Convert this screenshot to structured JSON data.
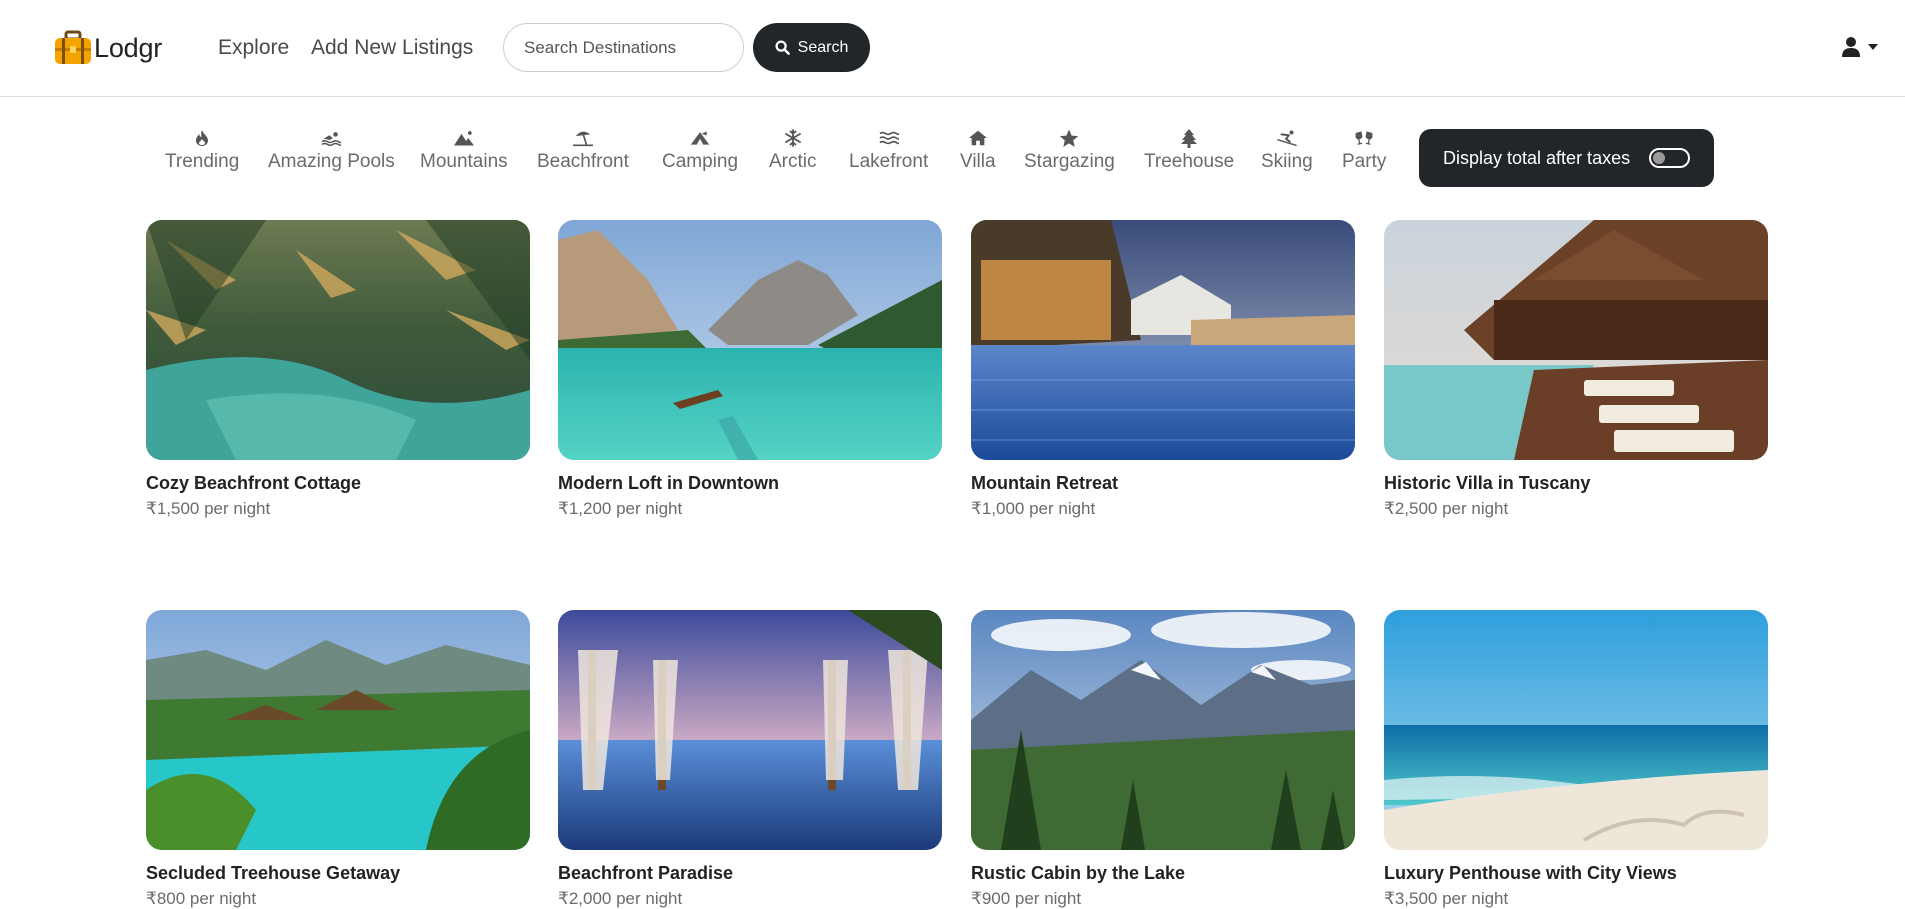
{
  "brand": {
    "name": "Lodgr",
    "icon": "suitcase-icon"
  },
  "nav": {
    "explore": "Explore",
    "add_listing": "Add New Listings"
  },
  "search": {
    "placeholder": "Search Destinations",
    "button_label": "Search"
  },
  "user_menu": {
    "icon": "user-icon",
    "caret": "caret-down-icon"
  },
  "filters": [
    {
      "label": "Trending",
      "icon": "fire-icon"
    },
    {
      "label": "Amazing Pools",
      "icon": "swimmer-icon"
    },
    {
      "label": "Mountains",
      "icon": "mountain-icon"
    },
    {
      "label": "Beachfront",
      "icon": "umbrella-beach-icon"
    },
    {
      "label": "Camping",
      "icon": "campground-icon"
    },
    {
      "label": "Arctic",
      "icon": "snowflake-icon"
    },
    {
      "label": "Lakefront",
      "icon": "water-icon"
    },
    {
      "label": "Villa",
      "icon": "house-icon"
    },
    {
      "label": "Stargazing",
      "icon": "star-icon"
    },
    {
      "label": "Treehouse",
      "icon": "tree-icon"
    },
    {
      "label": "Skiing",
      "icon": "skiing-icon"
    },
    {
      "label": "Party",
      "icon": "glasses-cheers-icon"
    }
  ],
  "tax_toggle": {
    "label": "Display total after taxes",
    "enabled": false
  },
  "listings": [
    {
      "title": "Cozy Beachfront Cottage",
      "price": "₹1,500 per night"
    },
    {
      "title": "Modern Loft in Downtown",
      "price": "₹1,200 per night"
    },
    {
      "title": "Mountain Retreat",
      "price": "₹1,000 per night"
    },
    {
      "title": "Historic Villa in Tuscany",
      "price": "₹2,500 per night"
    },
    {
      "title": "Secluded Treehouse Getaway",
      "price": "₹800 per night"
    },
    {
      "title": "Beachfront Paradise",
      "price": "₹2,000 per night"
    },
    {
      "title": "Rustic Cabin by the Lake",
      "price": "₹900 per night"
    },
    {
      "title": "Luxury Penthouse with City Views",
      "price": "₹3,500 per night"
    }
  ],
  "colors": {
    "dark": "#222529",
    "muted": "#6b6b6b",
    "logo_orange": "#f4a300"
  }
}
